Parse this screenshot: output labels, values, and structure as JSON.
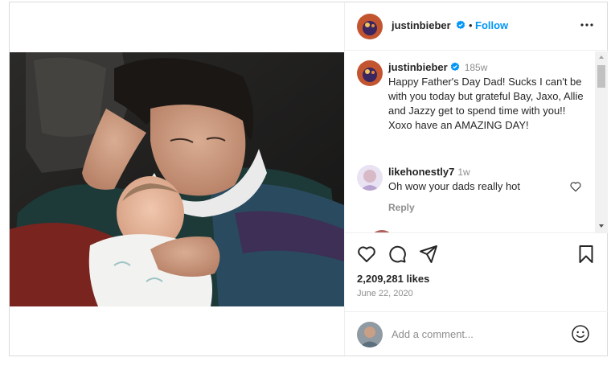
{
  "header": {
    "username": "justinbieber",
    "separator": "•",
    "follow_label": "Follow"
  },
  "caption": {
    "username": "justinbieber",
    "time": "185w",
    "text": "Happy Father's Day Dad! Sucks I can't be with you today but grateful Bay, Jaxo, Allie and Jazzy get to spend time with you!! Xoxo have an AMAZING DAY!"
  },
  "comments": [
    {
      "username": "likehonestly7",
      "time": "1w",
      "text": "Oh wow your dads really hot",
      "reply_label": "Reply"
    }
  ],
  "actions": {
    "likes": "2,209,281 likes",
    "date": "June 22, 2020"
  },
  "add_comment": {
    "placeholder": "Add a comment..."
  },
  "icons": [
    "verified-badge-icon",
    "more-options-icon",
    "heart-icon",
    "comment-icon",
    "share-icon",
    "bookmark-icon",
    "emoji-icon"
  ],
  "colors": {
    "link_blue": "#0095f6",
    "text": "#262626",
    "muted": "#8e8e8e",
    "border": "#dbdbdb"
  }
}
